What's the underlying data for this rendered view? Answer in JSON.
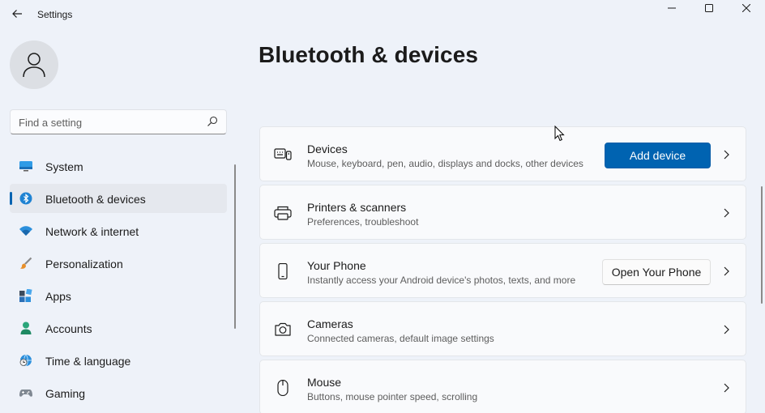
{
  "window": {
    "title": "Settings",
    "icons": {
      "back": "back-arrow-icon",
      "minimize": "minimize-icon",
      "maximize": "maximize-icon",
      "close": "close-icon"
    }
  },
  "user": {
    "avatar_icon": "person-icon"
  },
  "search": {
    "placeholder": "Find a setting",
    "value": "",
    "icon": "search-icon"
  },
  "sidebar": {
    "active_index": 1,
    "items": [
      {
        "label": "System",
        "icon": "system-icon"
      },
      {
        "label": "Bluetooth & devices",
        "icon": "bluetooth-icon"
      },
      {
        "label": "Network & internet",
        "icon": "wifi-icon"
      },
      {
        "label": "Personalization",
        "icon": "brush-icon"
      },
      {
        "label": "Apps",
        "icon": "apps-icon"
      },
      {
        "label": "Accounts",
        "icon": "accounts-icon"
      },
      {
        "label": "Time & language",
        "icon": "globe-clock-icon"
      },
      {
        "label": "Gaming",
        "icon": "gamepad-icon"
      }
    ]
  },
  "main": {
    "title": "Bluetooth & devices",
    "cards": [
      {
        "title": "Devices",
        "subtitle": "Mouse, keyboard, pen, audio, displays and docks, other devices",
        "icon": "devices-icon",
        "button": "Add device"
      },
      {
        "title": "Printers & scanners",
        "subtitle": "Preferences, troubleshoot",
        "icon": "printer-icon"
      },
      {
        "title": "Your Phone",
        "subtitle": "Instantly access your Android device's photos, texts, and more",
        "icon": "phone-icon",
        "button": "Open Your Phone"
      },
      {
        "title": "Cameras",
        "subtitle": "Connected cameras, default image settings",
        "icon": "camera-icon"
      },
      {
        "title": "Mouse",
        "subtitle": "Buttons, mouse pointer speed, scrolling",
        "icon": "mouse-icon"
      }
    ]
  },
  "colors": {
    "accent": "#0063b1",
    "background": "#eef2f9",
    "card": "#f9fafc"
  }
}
